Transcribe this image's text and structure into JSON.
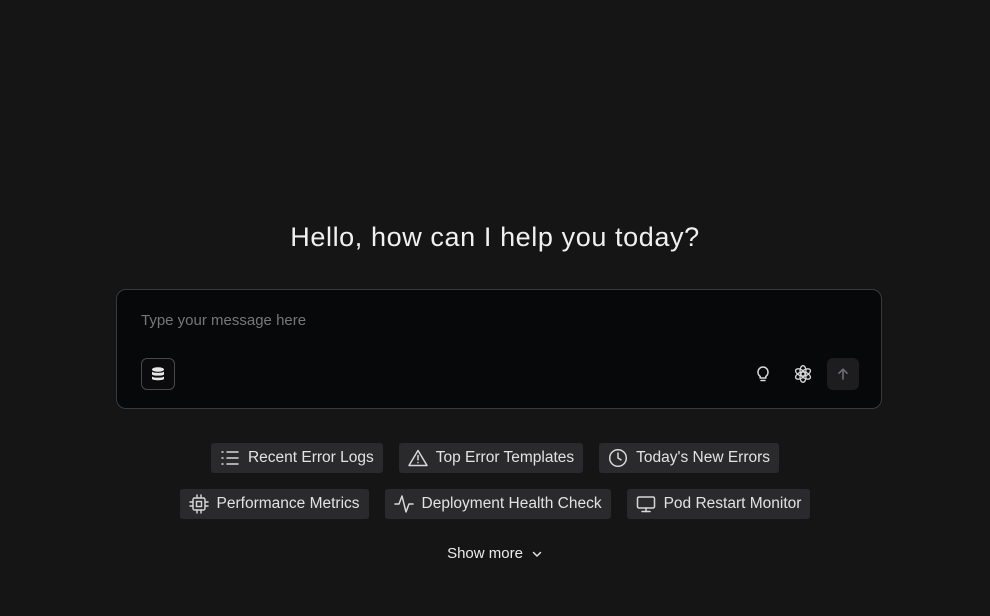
{
  "greeting": "Hello, how can I help you today?",
  "composer": {
    "placeholder": "Type your message here",
    "value": ""
  },
  "icons": {
    "database": "database-icon",
    "idea": "lightbulb-icon",
    "model": "openai-icon",
    "send": "arrow-up-icon"
  },
  "suggestions": {
    "row1": [
      {
        "label": "Recent Error Logs",
        "icon": "list-icon"
      },
      {
        "label": "Top Error Templates",
        "icon": "warning-triangle-icon"
      },
      {
        "label": "Today's New Errors",
        "icon": "clock-icon"
      }
    ],
    "row2": [
      {
        "label": "Performance Metrics",
        "icon": "cpu-icon"
      },
      {
        "label": "Deployment Health Check",
        "icon": "activity-icon"
      },
      {
        "label": "Pod Restart Monitor",
        "icon": "monitor-icon"
      }
    ]
  },
  "show_more": {
    "label": "Show more",
    "icon": "chevron-down-icon"
  },
  "colors": {
    "background": "#151515",
    "composer_bg": "#07080a",
    "chip_bg": "#2a2a2c"
  }
}
